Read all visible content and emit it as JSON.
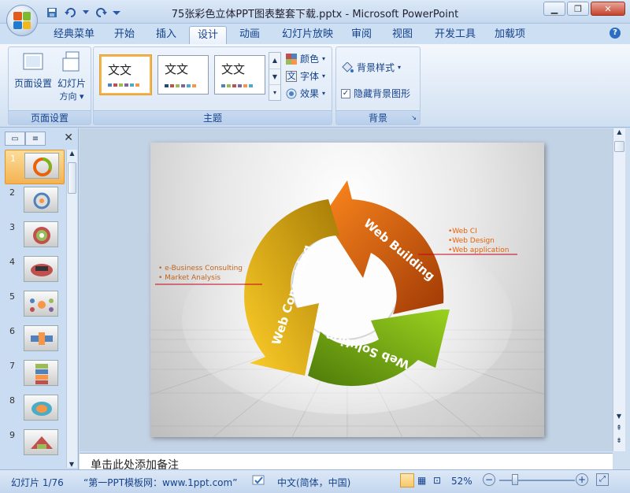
{
  "window": {
    "title": "75张彩色立体PPT图表整套下载.pptx - Microsoft PowerPoint",
    "min_icon": "minimize-icon",
    "max_icon": "restore-icon",
    "close_icon": "close-icon"
  },
  "tabs": [
    {
      "label": "经典菜单"
    },
    {
      "label": "开始"
    },
    {
      "label": "插入"
    },
    {
      "label": "设计"
    },
    {
      "label": "动画"
    },
    {
      "label": "幻灯片放映"
    },
    {
      "label": "审阅"
    },
    {
      "label": "视图"
    },
    {
      "label": "开发工具"
    },
    {
      "label": "加载项"
    }
  ],
  "ribbon": {
    "page_setup": {
      "label": "页面设置",
      "btn_page_setup": "页面设置",
      "btn_orientation_line1": "幻灯片",
      "btn_orientation_line2": "方向"
    },
    "themes": {
      "label": "主题",
      "sample_text": "文文",
      "colors": "颜色",
      "fonts": "字体",
      "effects": "效果"
    },
    "background": {
      "label": "背景",
      "styles": "背景样式",
      "hide_graphics": "隐藏背景图形"
    }
  },
  "slides_pane": {
    "numbers": [
      "1",
      "2",
      "3",
      "4",
      "5",
      "6",
      "7",
      "8",
      "9"
    ],
    "selected": 1
  },
  "slide": {
    "segments": [
      "Web Building",
      "Web Solution",
      "Web Consulting"
    ],
    "right_bullets": [
      "•Web CI",
      "•Web Design",
      "•Web application"
    ],
    "left_bullets": [
      "• e-Business Consulting",
      "• Market Analysis"
    ]
  },
  "notes": {
    "placeholder": "单击此处添加备注"
  },
  "status": {
    "slide": "幻灯片 1/76",
    "theme": "“第一PPT模板网：www.1ppt.com”",
    "language": "中文(简体，中国)",
    "zoom": "52%"
  },
  "colors": {
    "accent": "#2b6ec4",
    "orange": "#e8620a",
    "green": "#7fb31d",
    "yellow": "#e2a90b"
  }
}
